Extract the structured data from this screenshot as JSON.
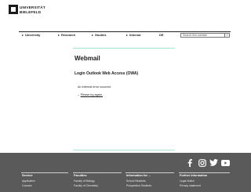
{
  "header": {
    "logo_line1": "UNIVERSITÄT",
    "logo_line2": "BIELEFELD"
  },
  "nav": {
    "items": [
      {
        "label": "University"
      },
      {
        "label": "Research"
      },
      {
        "label": "Studies"
      },
      {
        "label": "Internal"
      },
      {
        "label": "DE"
      }
    ],
    "search_placeholder": "Search this website",
    "search_button": "›"
  },
  "main": {
    "title": "Webmail",
    "subtitle": "Login Outlook Web Access (OWA)",
    "error": "An internal error occured.",
    "retry_dash": "–",
    "retry_link": "Please try again."
  },
  "footer": {
    "social_icons": [
      "facebook-icon",
      "instagram-icon",
      "twitter-icon",
      "youtube-icon"
    ],
    "columns": [
      {
        "heading": "Service",
        "links": [
          "Application",
          "Courses"
        ]
      },
      {
        "heading": "Faculties",
        "links": [
          "Faculty of Biology",
          "Faculty of Chemistry"
        ]
      },
      {
        "heading": "Information for ...",
        "links": [
          "School Students",
          "Prospective Students"
        ]
      },
      {
        "heading": "Further Information",
        "links": [
          "Legal Notice",
          "Privacy statement"
        ]
      }
    ]
  },
  "colors": {
    "accent_green": "#a9e5cf",
    "footer_bg": "#5a5a5a",
    "text": "#1a1a1a"
  }
}
